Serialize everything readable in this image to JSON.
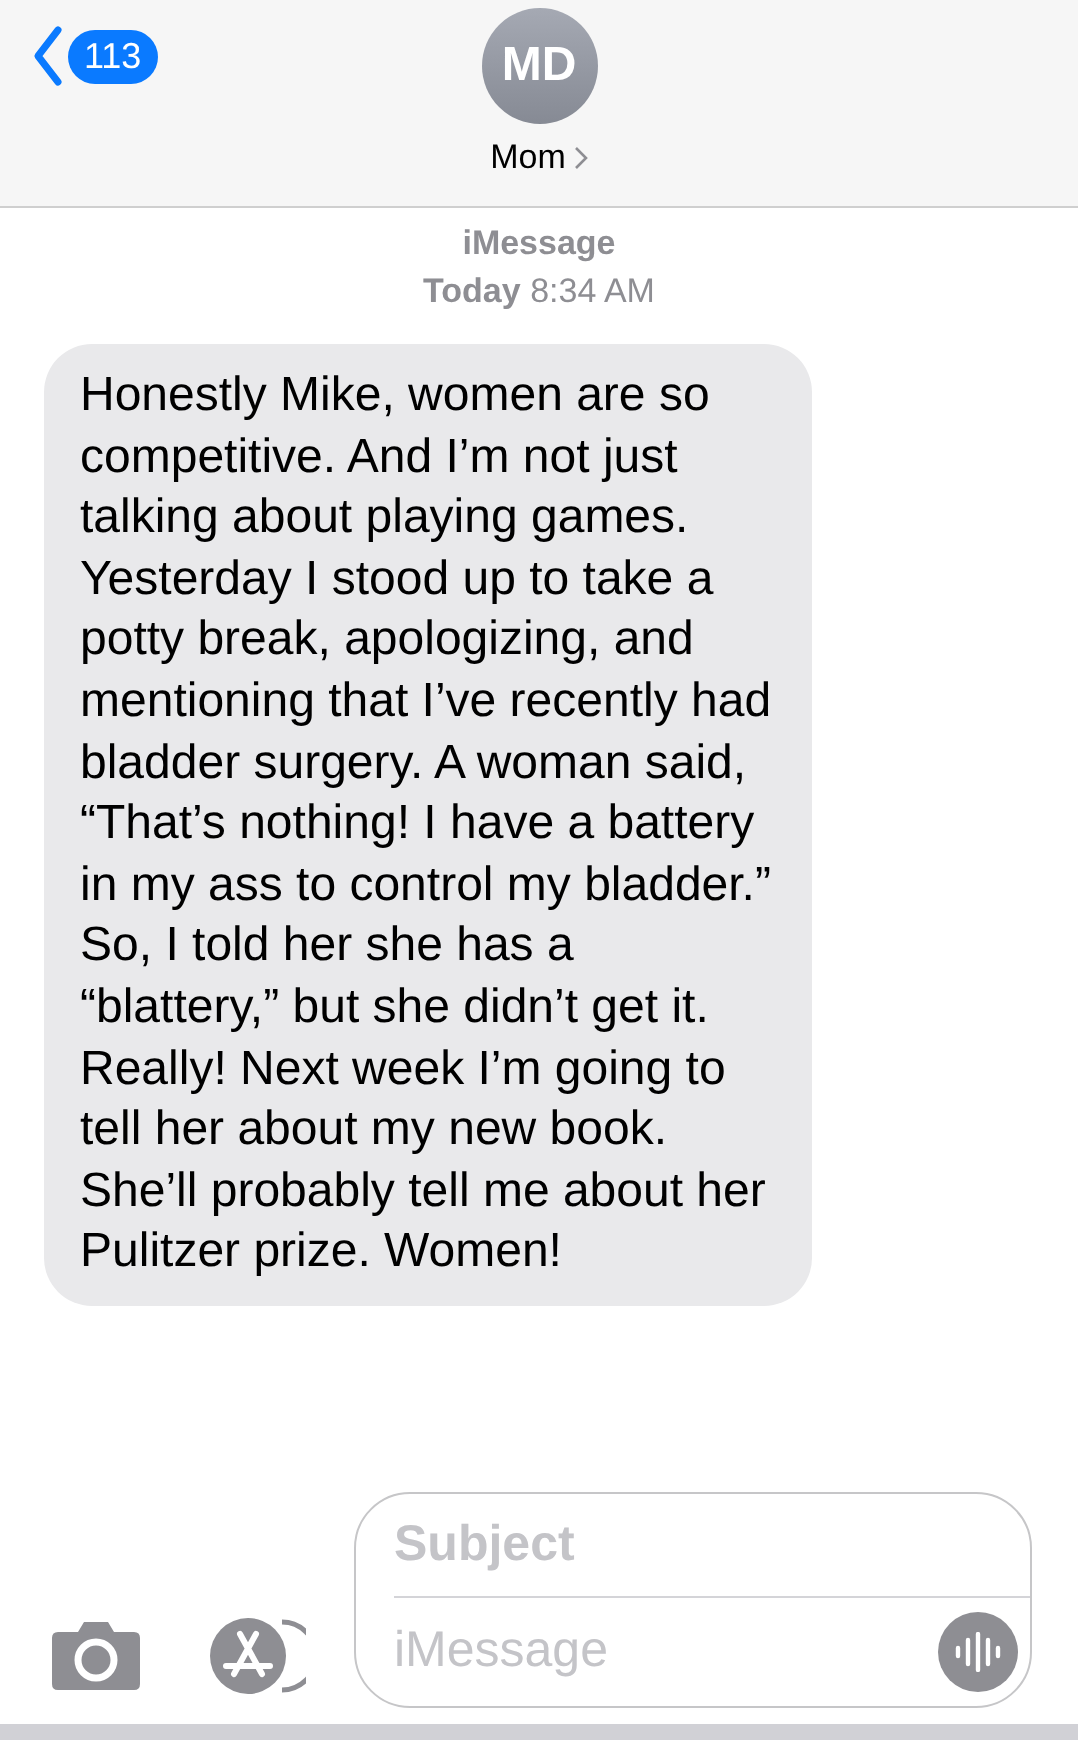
{
  "header": {
    "back_count": "113",
    "avatar_initials": "MD",
    "contact_name": "Mom"
  },
  "conversation": {
    "service": "iMessage",
    "date_day": "Today",
    "date_time": "8:34 AM"
  },
  "messages": [
    {
      "kind": "incoming",
      "text": "Honestly Mike, women are so competitive. And I’m not just talking about playing games. Yesterday I stood up to take a potty break, apologizing, and mentioning that I’ve recently had bladder surgery. A woman said, “That’s nothing! I have a battery in my ass to control my bladder.” So, I told her she has a “blattery,” but she didn’t get it. Really! Next week I’m going to tell her about my new book. She’ll probably tell me about her Pulitzer prize. Women!"
    }
  ],
  "composer": {
    "subject_placeholder": "Subject",
    "message_placeholder": "iMessage"
  }
}
